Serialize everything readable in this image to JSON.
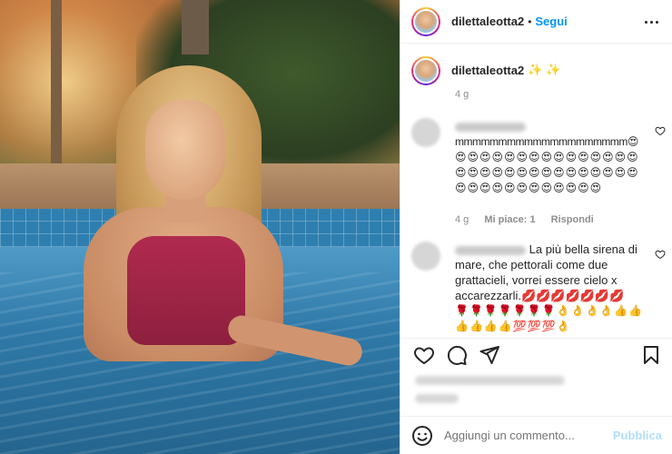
{
  "header": {
    "username": "dilettaleotta2",
    "separator": "•",
    "follow_label": "Segui"
  },
  "caption": {
    "username": "dilettaleotta2",
    "text": "✨ ✨",
    "age": "4 g"
  },
  "comments": [
    {
      "text": "mmmmmmmmmmmmmmmmmmmm😍",
      "emoji": "😍😍😍😍😍😍😍😍😍😍😍😍😍😍😍😍😍😍😍😍😍😍😍😍😍😍😍😍😍😍😍😍😍😍😍😍😍😍😍😍😍😍",
      "age": "4 g",
      "likes": "Mi piace: 1",
      "reply_label": "Rispondi"
    },
    {
      "text": "La più bella sirena di mare, che pettorali come due grattacieli, vorrei essere cielo x accarezzarli.💋💋💋💋💋💋💋",
      "emoji": "🌹🌹🌹🌹🌹🌹🌹👌👌👌👌👍👍👍👍👍👍💯💯💯👌"
    }
  ],
  "add_comment": {
    "placeholder": "Aggiungi un commento...",
    "publish_label": "Pubblica"
  },
  "colors": {
    "link_blue": "#0095f6",
    "publish_disabled": "#b2dffc",
    "text": "#262626",
    "muted": "#8e8e8e",
    "divider": "#efefef"
  },
  "icons": {
    "more": "more-horizontal-icon",
    "like": "heart-icon",
    "comment": "comment-icon",
    "share": "paper-plane-icon",
    "save": "bookmark-icon",
    "emoji": "smiley-icon"
  }
}
